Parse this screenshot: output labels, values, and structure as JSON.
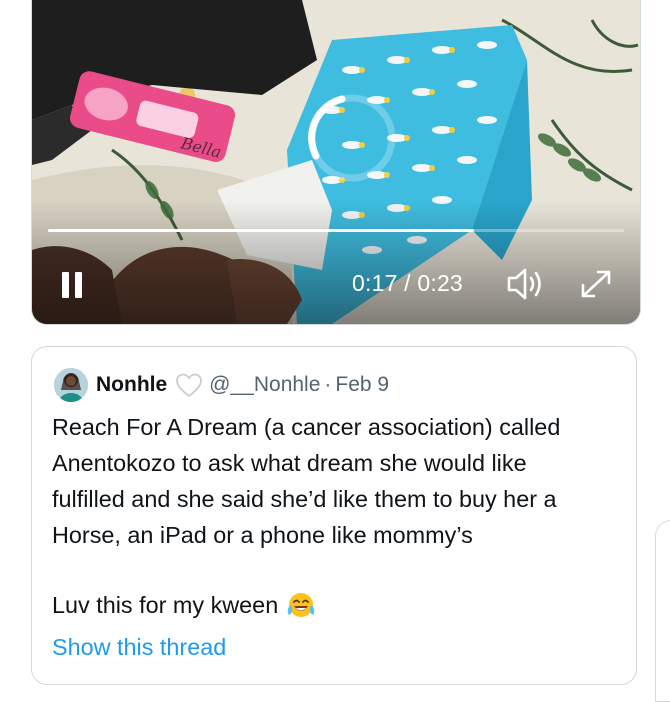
{
  "video": {
    "current_time": "0:17",
    "duration": "0:23",
    "time_separator": " / ",
    "progress_fraction": 0.74,
    "state": "playing",
    "icons": {
      "pause": "pause-icon",
      "volume": "volume-icon",
      "fullscreen": "fullscreen-icon",
      "loading": "loading-spinner-icon"
    },
    "package_label": "Bella"
  },
  "quote": {
    "author_name": "Nonhle",
    "handle": "@__Nonhle",
    "separator": "·",
    "date": "Feb 9",
    "text": "Reach For A Dream (a cancer association) called\nAnentokozo to ask what dream she would like\nfulfilled and she said she’d like them to buy her a\nHorse, an iPad or a phone like mommy’s",
    "text2": "Luv this for my kween",
    "emoji": "face-with-tears-of-joy",
    "show_thread": "Show this thread",
    "colors": {
      "link": "#1d9bf0",
      "muted": "#536471",
      "text": "#0f1419",
      "border": "#cfd9de"
    }
  }
}
